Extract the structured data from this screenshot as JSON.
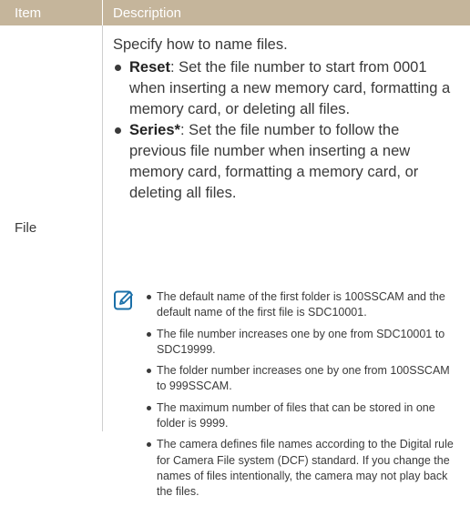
{
  "header": {
    "item_label": "Item",
    "description_label": "Description"
  },
  "row": {
    "item": "File",
    "intro": "Specify how to name files.",
    "bullets": [
      {
        "term": "Reset",
        "text": ": Set the file number to start from 0001 when inserting a new memory card, formatting a memory card, or deleting all files."
      },
      {
        "term": "Series*",
        "text": ": Set the file number to follow the previous file number when inserting a new memory card, formatting a memory card, or deleting all files."
      }
    ],
    "note_icon": "note-pencil-icon",
    "notes": [
      "The default name of the first folder is 100SSCAM and the default name of the first file is SDC10001.",
      "The file number increases one by one from SDC10001 to SDC19999.",
      "The folder number increases one by one from 100SSCAM to 999SSCAM.",
      "The maximum number of files that can be stored in one folder is 9999.",
      "The camera defines file names according to the Digital rule for Camera File system (DCF) standard. If you change the names of files intentionally, the camera may not play back the files."
    ]
  },
  "colors": {
    "header_bg": "#c5b59b",
    "icon_blue": "#1a6fa8",
    "text": "#3a3a3a"
  }
}
